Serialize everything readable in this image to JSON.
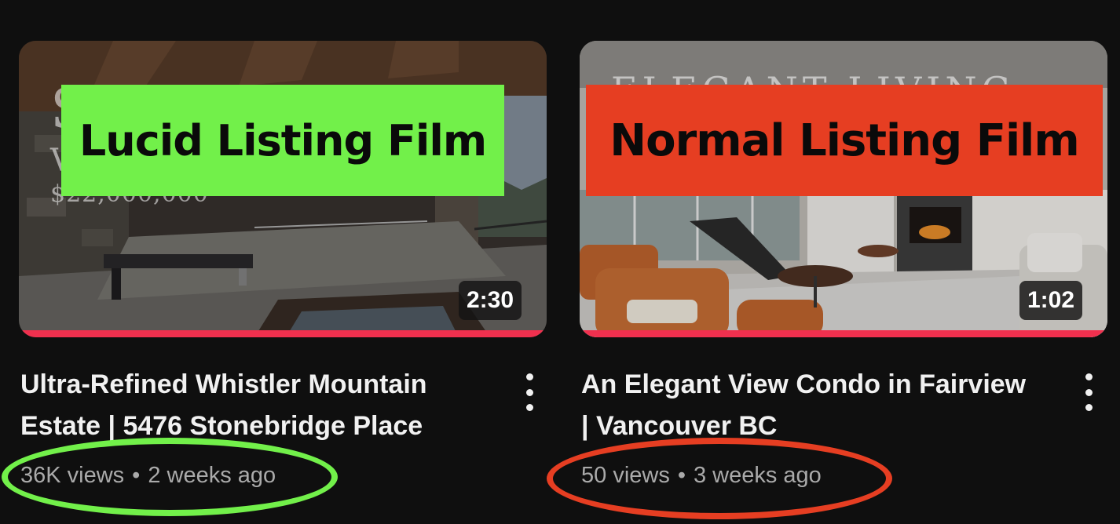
{
  "colors": {
    "background": "#0f0f0f",
    "lucid_banner": "#72f04a",
    "normal_banner": "#e63e22",
    "progress_bar": "#f0304e",
    "green_ring": "#72f04a",
    "red_ring": "#e63e22"
  },
  "videos": [
    {
      "thumbnail_ghost_lines": [
        "S",
        "V",
        "$22,000,000"
      ],
      "banner": "Lucid Listing Film",
      "duration": "2:30",
      "watched_fraction": 1.0,
      "title": "Ultra-Refined Whistler Mountain Estate | 5476 Stonebridge Place",
      "views": "36K views",
      "age": "2 weeks ago",
      "more_icon": "more-vert-icon"
    },
    {
      "thumbnail_ghost_lines": [
        "ELEGANT LIVING"
      ],
      "banner": "Normal Listing Film",
      "duration": "1:02",
      "watched_fraction": 1.0,
      "title": "An Elegant View Condo in Fairview | Vancouver BC",
      "views": "50 views",
      "age": "3 weeks ago",
      "more_icon": "more-vert-icon"
    }
  ],
  "separator": "•"
}
